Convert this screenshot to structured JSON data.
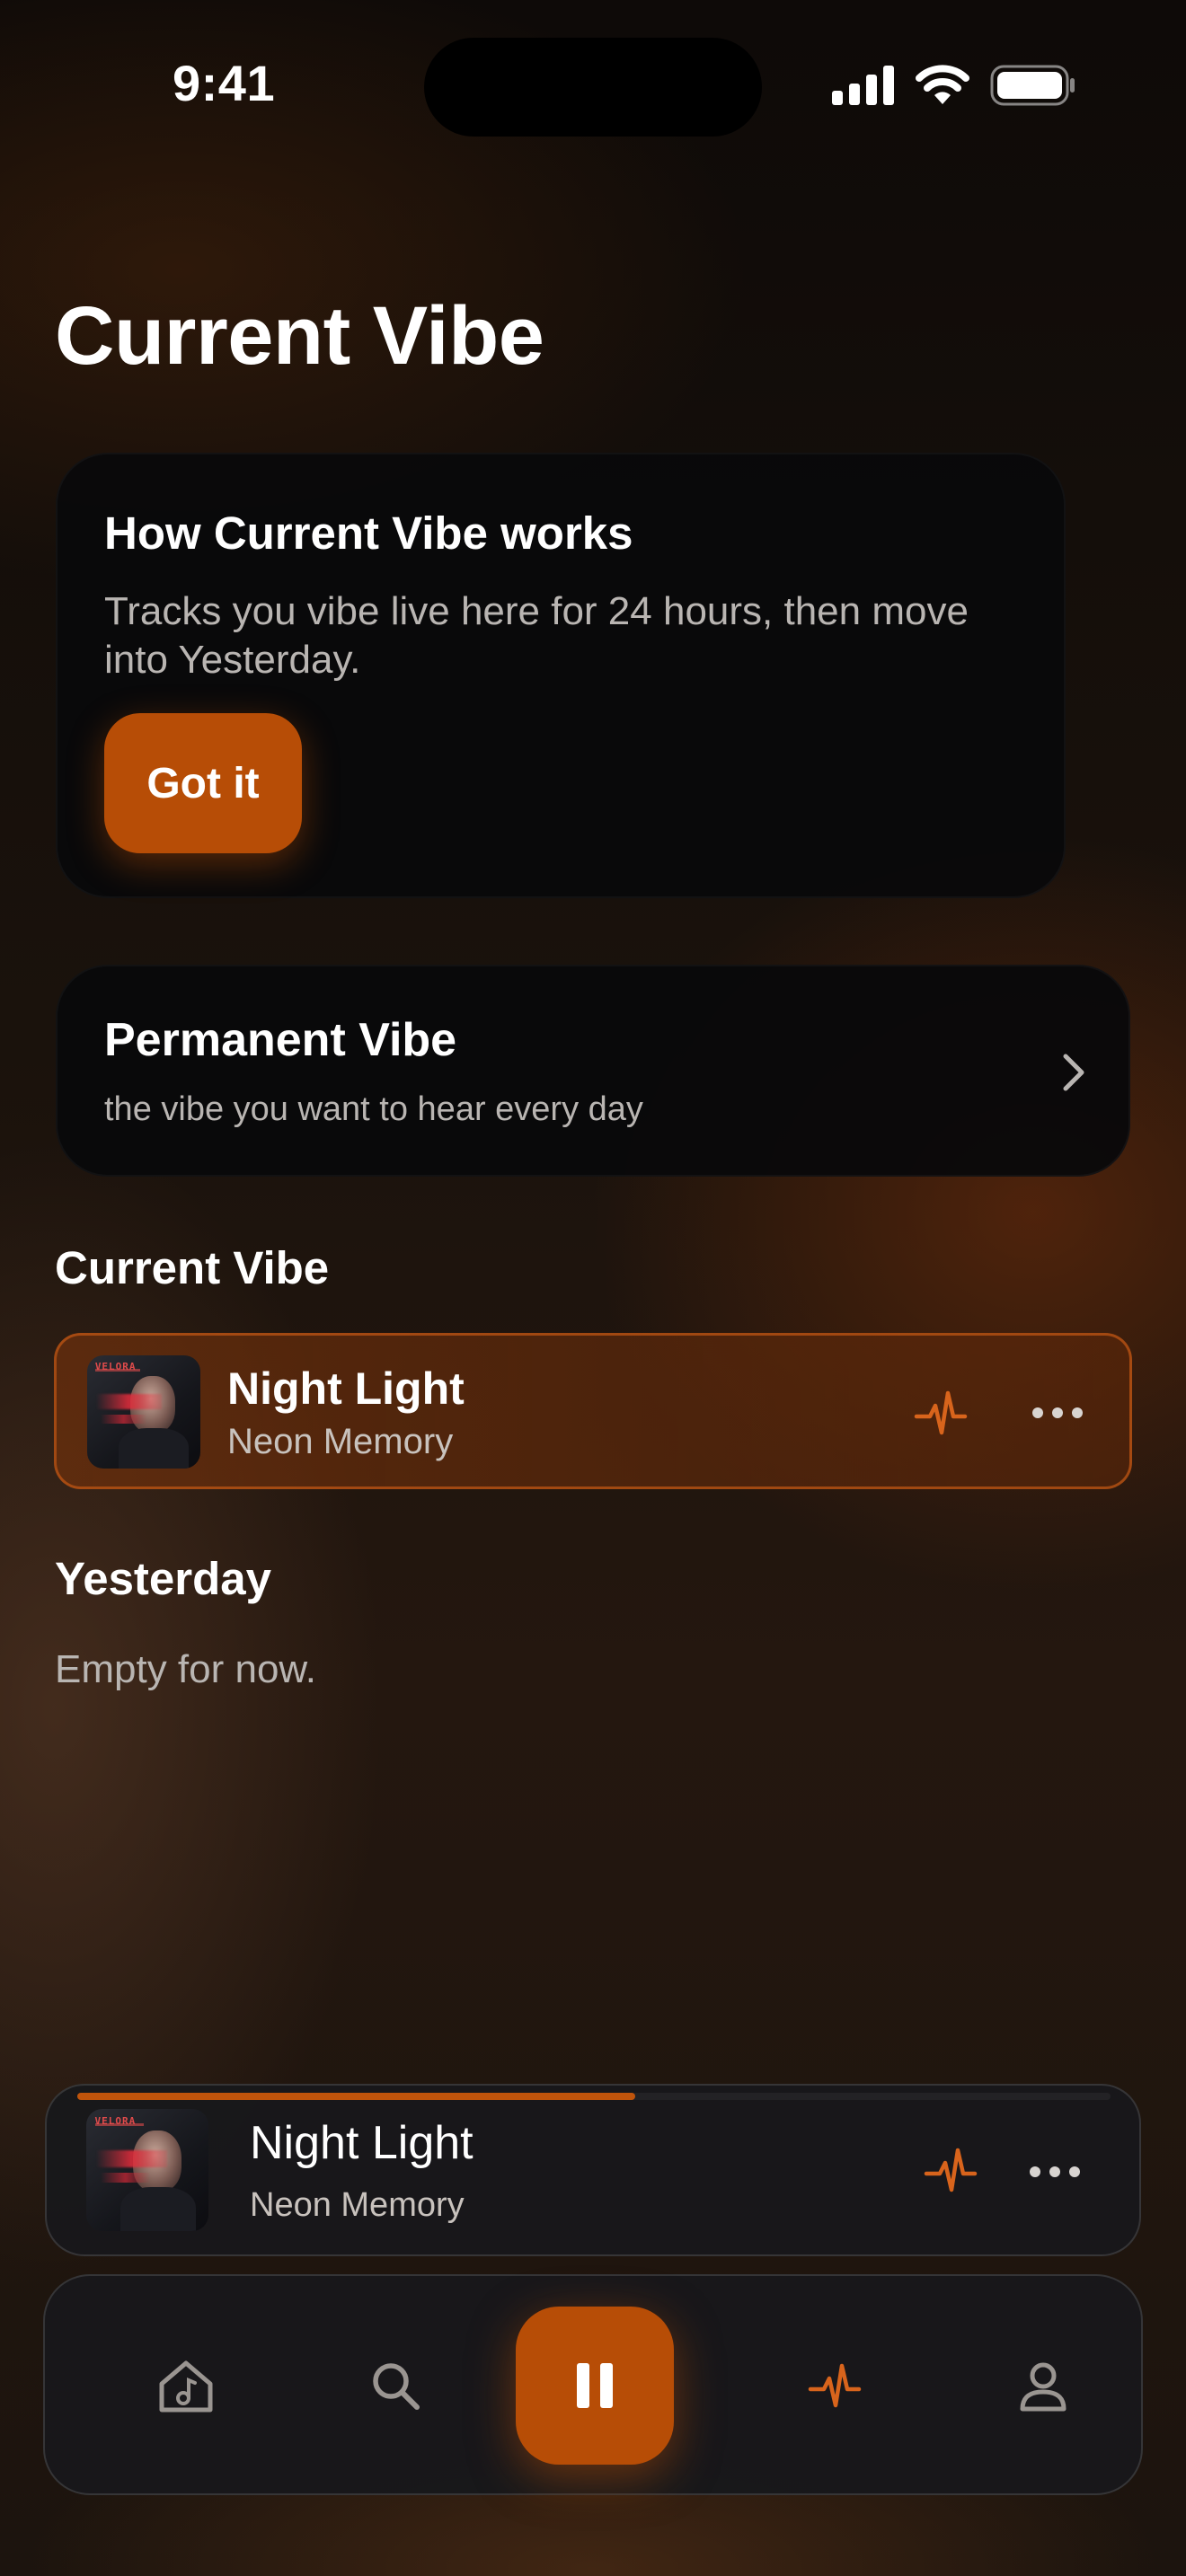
{
  "status_bar": {
    "time": "9:41"
  },
  "page_title": "Current Vibe",
  "info_card": {
    "title": "How Current Vibe works",
    "description": "Tracks you vibe live here for 24 hours, then move into Yesterday.",
    "button_label": "Got it"
  },
  "permanent_vibe": {
    "title": "Permanent Vibe",
    "subtitle": "the vibe you want to hear every day"
  },
  "current_vibe_section": {
    "heading": "Current Vibe",
    "tracks": [
      {
        "title": "Night Light",
        "artist": "Neon Memory",
        "cover_text": "VELORA"
      }
    ]
  },
  "yesterday_section": {
    "heading": "Yesterday",
    "empty_text": "Empty for now."
  },
  "now_playing": {
    "title": "Night Light",
    "artist": "Neon Memory",
    "cover_text": "VELORA",
    "progress": 0.54
  },
  "tab_bar": {
    "tabs": [
      {
        "icon": "home-music-icon",
        "active": false
      },
      {
        "icon": "search-icon",
        "active": false
      },
      {
        "icon": "pause-icon",
        "active": true
      },
      {
        "icon": "pulse-icon",
        "active": true
      },
      {
        "icon": "profile-icon",
        "active": false
      }
    ]
  },
  "colors": {
    "accent": "#B74D06",
    "accent_light": "#D8641C",
    "background": "#140E0A",
    "card": "#0A0A0C"
  }
}
